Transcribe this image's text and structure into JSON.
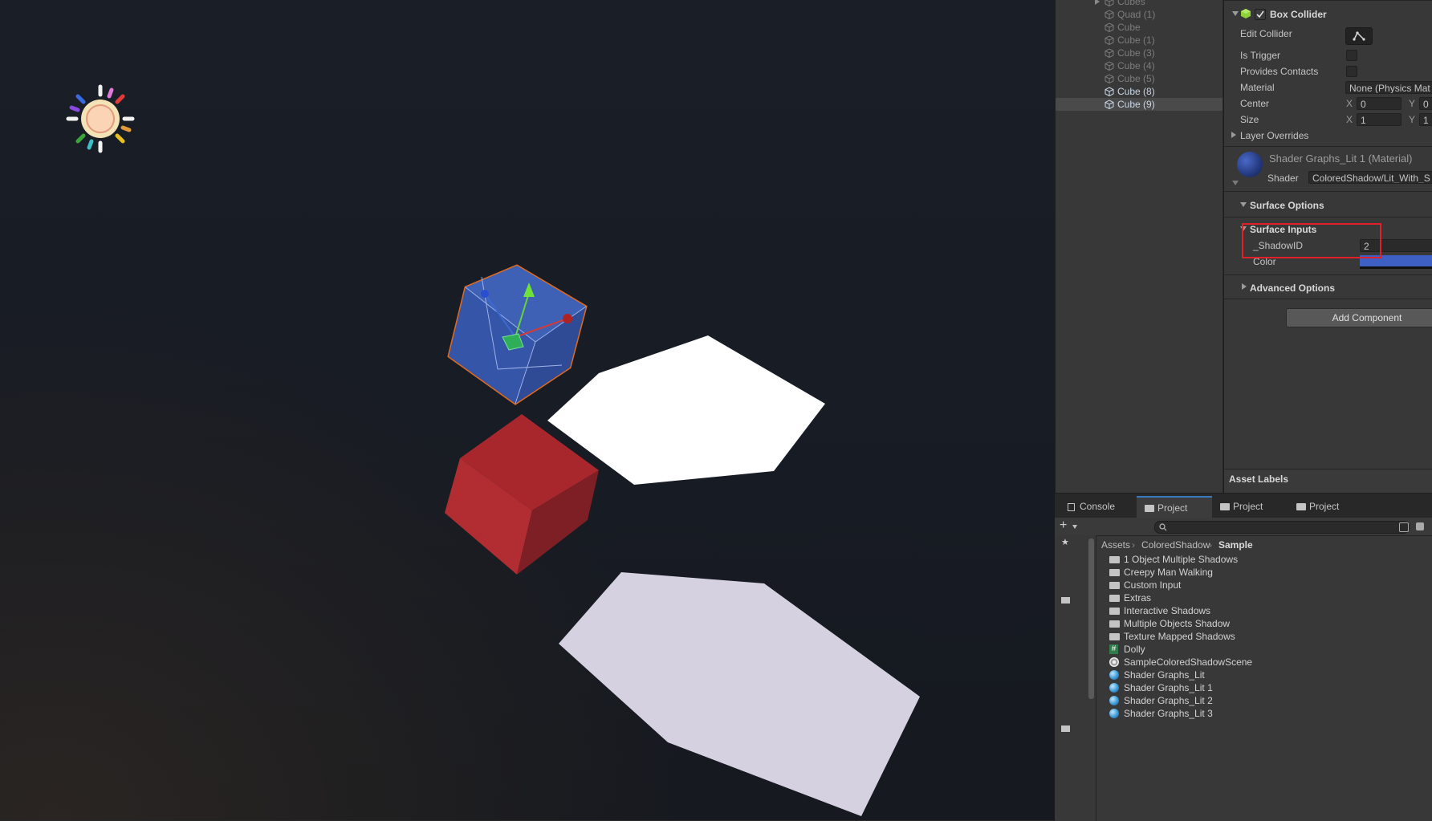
{
  "hierarchy": {
    "items": [
      {
        "label": "Cubes",
        "state": "dim"
      },
      {
        "label": "Quad (1)",
        "state": "dim"
      },
      {
        "label": "Cube",
        "state": "dim"
      },
      {
        "label": "Cube (1)",
        "state": "dim"
      },
      {
        "label": "Cube (3)",
        "state": "dim"
      },
      {
        "label": "Cube (4)",
        "state": "dim"
      },
      {
        "label": "Cube (5)",
        "state": "dim"
      },
      {
        "label": "Cube (8)",
        "state": "bright"
      },
      {
        "label": "Cube (9)",
        "state": "selected"
      }
    ]
  },
  "inspector": {
    "box_collider": {
      "title": "Box Collider",
      "edit_collider_label": "Edit Collider",
      "is_trigger_label": "Is Trigger",
      "provides_contacts_label": "Provides Contacts",
      "material_label": "Material",
      "material_value": "None (Physics Mat",
      "center_label": "Center",
      "center_x": "0",
      "center_y": "0",
      "size_label": "Size",
      "size_x": "1",
      "size_y": "1",
      "axis_x": "X",
      "axis_y": "Y",
      "layer_overrides_label": "Layer Overrides"
    },
    "material": {
      "name": "Shader Graphs_Lit 1 (Material)",
      "shader_label": "Shader",
      "shader_value": "ColoredShadow/Lit_With_S"
    },
    "surface_options_label": "Surface Options",
    "surface_inputs_label": "Surface Inputs",
    "shadow_id_label": "_ShadowID",
    "shadow_id_value": "2",
    "color_label": "Color",
    "color_value_hex": "#3e5fc4",
    "advanced_options_label": "Advanced Options",
    "add_component_label": "Add Component",
    "asset_labels_label": "Asset Labels"
  },
  "project_panel": {
    "tabs": [
      {
        "label": "Console",
        "icon": "console-icon"
      },
      {
        "label": "Project",
        "icon": "folder-icon"
      },
      {
        "label": "Project",
        "icon": "folder-icon"
      },
      {
        "label": "Project",
        "icon": "folder-icon"
      }
    ],
    "breadcrumb": [
      "Assets",
      "ColoredShadow",
      "Sample"
    ],
    "files": [
      {
        "label": "1 Object Multiple Shadows",
        "icon": "folder"
      },
      {
        "label": "Creepy Man Walking",
        "icon": "folder"
      },
      {
        "label": "Custom Input",
        "icon": "folder"
      },
      {
        "label": "Extras",
        "icon": "folder"
      },
      {
        "label": "Interactive Shadows",
        "icon": "folder"
      },
      {
        "label": "Multiple Objects Shadow",
        "icon": "folder"
      },
      {
        "label": "Texture Mapped Shadows",
        "icon": "folder"
      },
      {
        "label": "Dolly",
        "icon": "script"
      },
      {
        "label": "SampleColoredShadowScene",
        "icon": "scene"
      },
      {
        "label": "Shader Graphs_Lit",
        "icon": "material"
      },
      {
        "label": "Shader Graphs_Lit 1",
        "icon": "material"
      },
      {
        "label": "Shader Graphs_Lit 2",
        "icon": "material"
      },
      {
        "label": "Shader Graphs_Lit 3",
        "icon": "material"
      }
    ]
  },
  "colors": {
    "accent_tab": "#3a79bb",
    "highlight_box": "#e0202a",
    "selected_cube": "#3a5cb0",
    "red_cube": "#b3282e",
    "selection_outline": "#e06a1e"
  }
}
